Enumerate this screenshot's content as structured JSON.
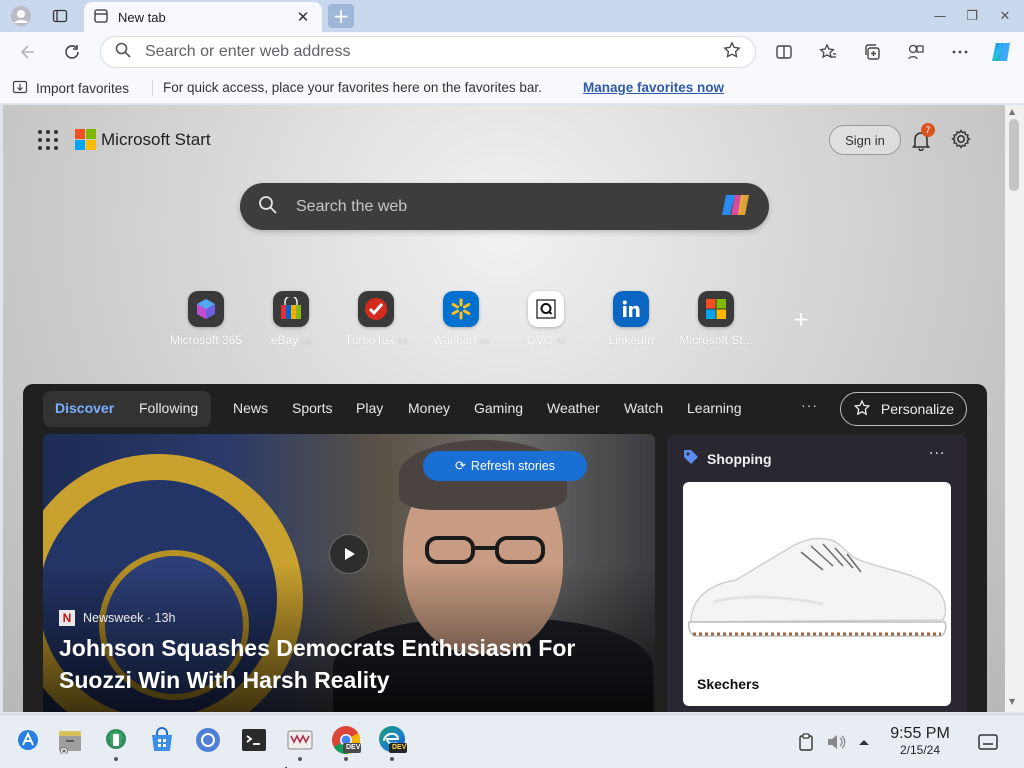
{
  "browser": {
    "tab": {
      "title": "New tab",
      "close_glyph": "✕"
    },
    "new_tab_glyph": "+",
    "window_controls": {
      "minimize": "—",
      "maximize": "❐",
      "close": "✕"
    },
    "address_bar": {
      "placeholder": "Search or enter web address"
    },
    "favorites_bar": {
      "import_label": "Import favorites",
      "message": "For quick access, place your favorites here on the favorites bar.",
      "manage_link": "Manage favorites now"
    }
  },
  "msstart": {
    "brand": "Microsoft Start",
    "sign_in": "Sign in",
    "notification_count": "7",
    "search_placeholder": "Search the web",
    "quicklinks": [
      {
        "label": "Microsoft 365",
        "ad": ""
      },
      {
        "label": "eBay",
        "ad": "Ad"
      },
      {
        "label": "TurboTax",
        "ad": "Ad"
      },
      {
        "label": "Walmart",
        "ad": "Ad"
      },
      {
        "label": "QVC",
        "ad": "Ad"
      },
      {
        "label": "LinkedIn",
        "ad": ""
      },
      {
        "label": "Microsoft St...",
        "ad": ""
      }
    ],
    "add_quicklink": "+"
  },
  "feed": {
    "tabs": {
      "discover": "Discover",
      "following": "Following"
    },
    "nav": [
      "News",
      "Sports",
      "Play",
      "Money",
      "Gaming",
      "Weather",
      "Watch",
      "Learning"
    ],
    "more": "···",
    "personalize": "Personalize",
    "refresh": "Refresh stories",
    "hero": {
      "source_logo": "N",
      "source": "Newsweek · 13h",
      "headline": "Johnson Squashes Democrats Enthusiasm For Suozzi Win With Harsh Reality"
    },
    "shopping": {
      "title": "Shopping",
      "more": "···",
      "item_name": "Skechers"
    }
  },
  "taskbar": {
    "time": "9:55 PM",
    "date": "2/15/24",
    "dev_badge": "DEV"
  },
  "colors": {
    "accent": "#1a6fd4",
    "discover": "#7ab0ff",
    "badge": "#d9541e",
    "link": "#2e5aa8"
  }
}
